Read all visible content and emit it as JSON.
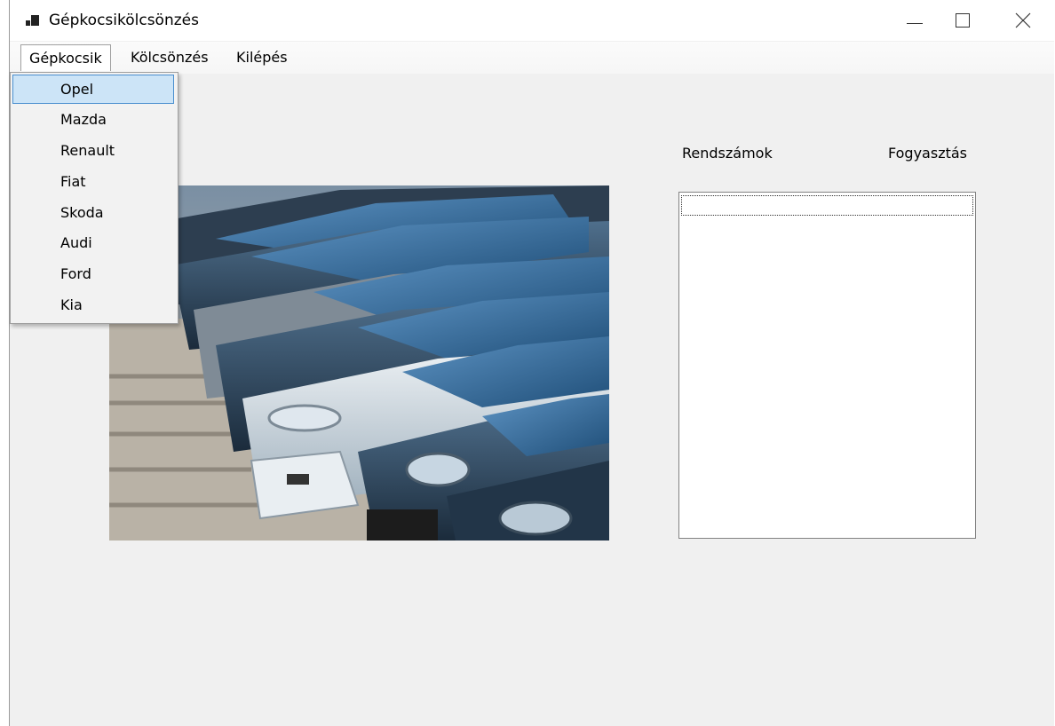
{
  "window": {
    "title": "Gépkocsikölcsönzés",
    "icons": {
      "app": "app-window-icon",
      "minimize": "minimize-icon",
      "maximize": "maximize-icon",
      "close": "close-icon"
    }
  },
  "menubar": {
    "items": [
      {
        "label": "Gépkocsik",
        "open": true
      },
      {
        "label": "Kölcsönzés"
      },
      {
        "label": "Kilépés"
      }
    ]
  },
  "dropdown": {
    "selected": "Opel",
    "items": [
      "Opel",
      "Mazda",
      "Renault",
      "Fiat",
      "Skoda",
      "Audi",
      "Ford",
      "Kia"
    ]
  },
  "labels": {
    "plates": "Rendszámok",
    "consumption": "Fogyasztás"
  },
  "listbox": {
    "items": []
  },
  "colors": {
    "menu_highlight": "#cce4f7",
    "menu_highlight_border": "#4a8fcf",
    "window_bg": "#f0f0f0"
  }
}
